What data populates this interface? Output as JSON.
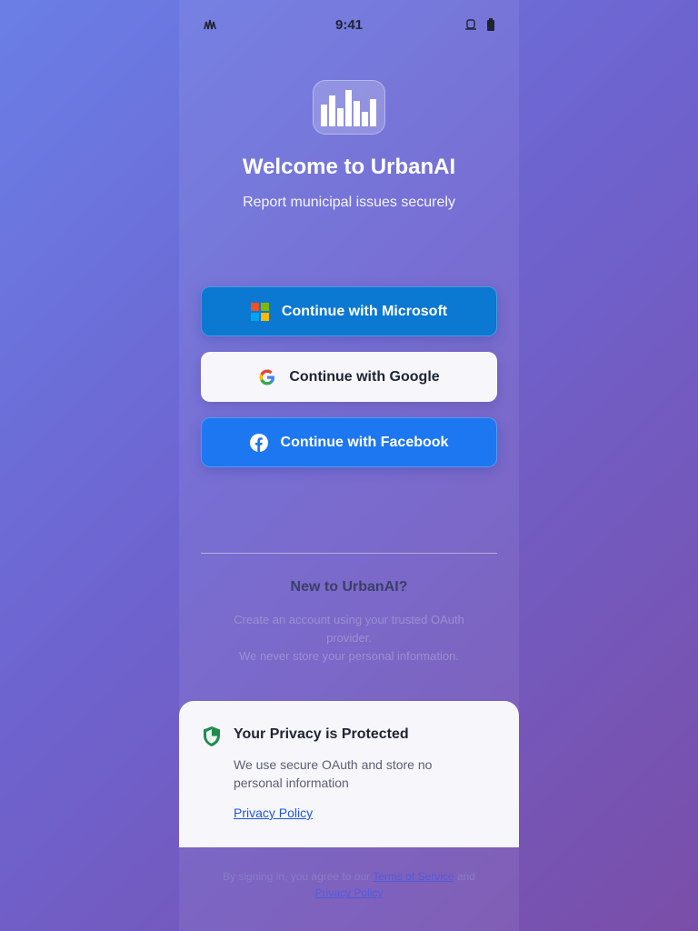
{
  "status_bar": {
    "time": "9:41"
  },
  "header": {
    "title": "Welcome to UrbanAI",
    "subtitle": "Report municipal issues securely"
  },
  "auth": {
    "microsoft_label": "Continue with Microsoft",
    "google_label": "Continue with Google",
    "facebook_label": "Continue with Facebook"
  },
  "new_user": {
    "title": "New to UrbanAI?",
    "line1": "Create an account using your trusted OAuth provider.",
    "line2": "We never store your personal information."
  },
  "privacy": {
    "title": "Your Privacy is Protected",
    "text": "We use secure OAuth and store no personal information",
    "link": "Privacy Policy"
  },
  "footer": {
    "prefix": "By signing in, you agree to our",
    "terms": "Terms of Service",
    "and": "and",
    "privacy": "Privacy Policy"
  },
  "icons": [
    "signal-icon",
    "alarm-icon",
    "battery-icon",
    "app-logo-icon",
    "microsoft-icon",
    "google-icon",
    "facebook-icon",
    "shield-icon"
  ],
  "colors": {
    "microsoft_button": "#0b78d1",
    "facebook_button": "#1c77f0",
    "link": "#1d57e0",
    "shield": "#1e8a4f"
  }
}
